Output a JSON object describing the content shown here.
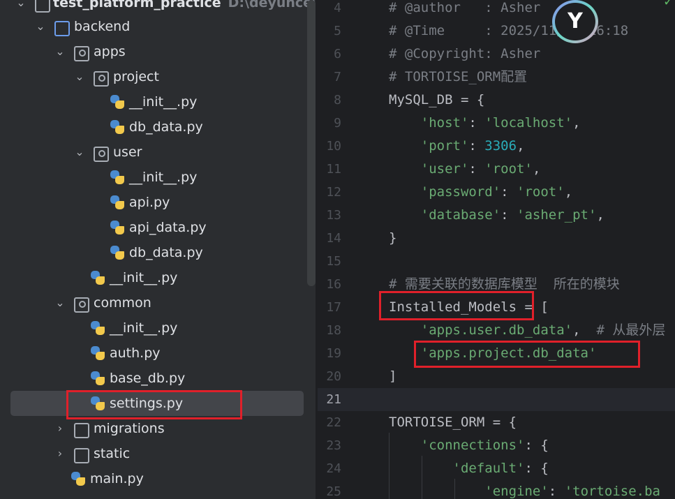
{
  "project_tree": {
    "root": {
      "name": "test_platform_practice",
      "path_hint": "D:\\deyunce\\test_pla"
    },
    "rows": [
      {
        "name": "backend"
      },
      {
        "name": "apps"
      },
      {
        "name": "project"
      },
      {
        "name": "__init__.py"
      },
      {
        "name": "db_data.py"
      },
      {
        "name": "user"
      },
      {
        "name": "__init__.py"
      },
      {
        "name": "api.py"
      },
      {
        "name": "api_data.py"
      },
      {
        "name": "db_data.py"
      },
      {
        "name": "__init__.py"
      },
      {
        "name": "common"
      },
      {
        "name": "__init__.py"
      },
      {
        "name": "auth.py"
      },
      {
        "name": "base_db.py"
      },
      {
        "name": "settings.py"
      },
      {
        "name": "migrations"
      },
      {
        "name": "static"
      },
      {
        "name": "main.py"
      }
    ]
  },
  "editor": {
    "lines": [
      {
        "no": "4",
        "tokens": [
          {
            "t": "# @author   : Asher",
            "c": "cm"
          }
        ]
      },
      {
        "no": "5",
        "tokens": [
          {
            "t": "# @Time     : 2025/11/16 16:18",
            "c": "cm"
          }
        ]
      },
      {
        "no": "6",
        "tokens": [
          {
            "t": "# @Copyright: Asher",
            "c": "cm"
          }
        ]
      },
      {
        "no": "7",
        "tokens": [
          {
            "t": "# TORTOISE_ORM配置",
            "c": "cm"
          }
        ]
      },
      {
        "no": "8",
        "tokens": [
          {
            "t": "MySQL_DB = {",
            "c": "pl"
          }
        ]
      },
      {
        "no": "9",
        "tokens": [
          {
            "t": "    ",
            "c": "pl"
          },
          {
            "t": "'host'",
            "c": "st"
          },
          {
            "t": ": ",
            "c": "pl"
          },
          {
            "t": "'localhost'",
            "c": "st"
          },
          {
            "t": ",",
            "c": "pl"
          }
        ]
      },
      {
        "no": "10",
        "tokens": [
          {
            "t": "    ",
            "c": "pl"
          },
          {
            "t": "'port'",
            "c": "st"
          },
          {
            "t": ": ",
            "c": "pl"
          },
          {
            "t": "3306",
            "c": "nu"
          },
          {
            "t": ",",
            "c": "pl"
          }
        ]
      },
      {
        "no": "11",
        "tokens": [
          {
            "t": "    ",
            "c": "pl"
          },
          {
            "t": "'user'",
            "c": "st"
          },
          {
            "t": ": ",
            "c": "pl"
          },
          {
            "t": "'root'",
            "c": "st"
          },
          {
            "t": ",",
            "c": "pl"
          }
        ]
      },
      {
        "no": "12",
        "tokens": [
          {
            "t": "    ",
            "c": "pl"
          },
          {
            "t": "'password'",
            "c": "st"
          },
          {
            "t": ": ",
            "c": "pl"
          },
          {
            "t": "'root'",
            "c": "st"
          },
          {
            "t": ",",
            "c": "pl"
          }
        ]
      },
      {
        "no": "13",
        "tokens": [
          {
            "t": "    ",
            "c": "pl"
          },
          {
            "t": "'database'",
            "c": "st"
          },
          {
            "t": ": ",
            "c": "pl"
          },
          {
            "t": "'asher_pt'",
            "c": "st"
          },
          {
            "t": ",",
            "c": "pl"
          }
        ]
      },
      {
        "no": "14",
        "tokens": [
          {
            "t": "}",
            "c": "pl"
          }
        ]
      },
      {
        "no": "15",
        "tokens": []
      },
      {
        "no": "16",
        "tokens": [
          {
            "t": "# 需要关联的数据库模型  所在的模块",
            "c": "cm"
          }
        ]
      },
      {
        "no": "17",
        "tokens": [
          {
            "t": "Installed_Models = [",
            "c": "pl"
          }
        ]
      },
      {
        "no": "18",
        "tokens": [
          {
            "t": "    ",
            "c": "pl"
          },
          {
            "t": "'apps.user.db_data'",
            "c": "st"
          },
          {
            "t": ",  ",
            "c": "pl"
          },
          {
            "t": "# 从最外层",
            "c": "cm"
          }
        ]
      },
      {
        "no": "19",
        "tokens": [
          {
            "t": "    ",
            "c": "pl"
          },
          {
            "t": "'apps.project.db_data'",
            "c": "st"
          }
        ]
      },
      {
        "no": "20",
        "tokens": [
          {
            "t": "]",
            "c": "pl"
          }
        ]
      },
      {
        "no": "21",
        "tokens": []
      },
      {
        "no": "22",
        "tokens": [
          {
            "t": "TORTOISE_ORM = {",
            "c": "pl"
          }
        ]
      },
      {
        "no": "23",
        "tokens": [
          {
            "t": "    ",
            "c": "pl"
          },
          {
            "t": "'connections'",
            "c": "st"
          },
          {
            "t": ": {",
            "c": "pl"
          }
        ]
      },
      {
        "no": "24",
        "tokens": [
          {
            "t": "        ",
            "c": "pl"
          },
          {
            "t": "'default'",
            "c": "st"
          },
          {
            "t": ": {",
            "c": "pl"
          }
        ]
      },
      {
        "no": "25",
        "tokens": [
          {
            "t": "            ",
            "c": "pl"
          },
          {
            "t": "'engine'",
            "c": "st"
          },
          {
            "t": ": ",
            "c": "pl"
          },
          {
            "t": "'tortoise.ba",
            "c": "st"
          }
        ]
      }
    ]
  },
  "colors": {
    "comment": "#7a7e85",
    "string": "#6aab73",
    "number": "#2aacb8",
    "highlight_box": "#e0202a"
  }
}
